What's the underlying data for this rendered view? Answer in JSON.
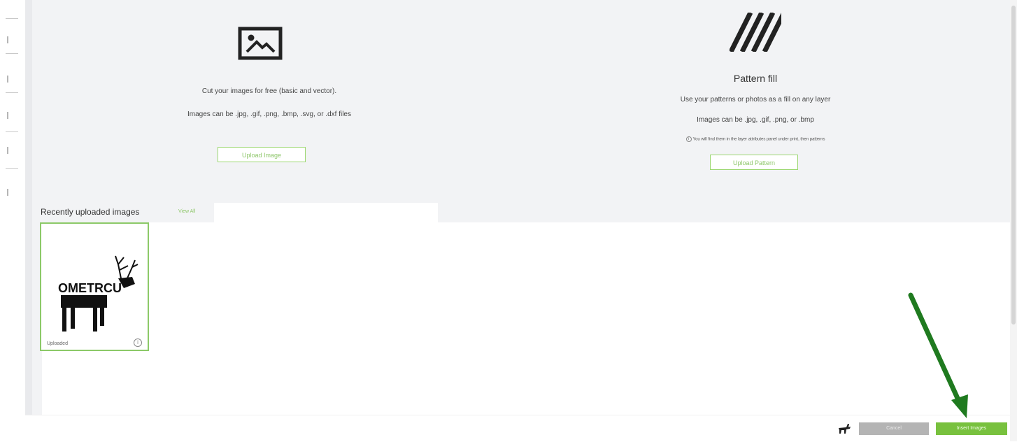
{
  "upload": {
    "line1": "Cut your images for free (basic and vector).",
    "line2": "Images can be .jpg, .gif, .png, .bmp, .svg, or .dxf files",
    "button_label": "Upload Image"
  },
  "pattern": {
    "title": "Pattern fill",
    "line1": "Use your patterns or photos as a fill on any layer",
    "line2": "Images can be .jpg, .gif, .png, or .bmp",
    "note": "You will find them in the layer attributes panel under print, then patterns",
    "button_label": "Upload Pattern"
  },
  "recent": {
    "title": "Recently uploaded images",
    "view_all": "View All",
    "items": [
      {
        "label": "Uploaded",
        "thumbnail_text": "OMETRCU"
      }
    ]
  },
  "footer": {
    "cancel_label": "Cancel",
    "insert_label": "Insert Images"
  },
  "colors": {
    "accent": "#78c13e",
    "outline": "#9bd76f",
    "panel_bg": "#f2f3f5",
    "arrow": "#1f7a1f"
  }
}
